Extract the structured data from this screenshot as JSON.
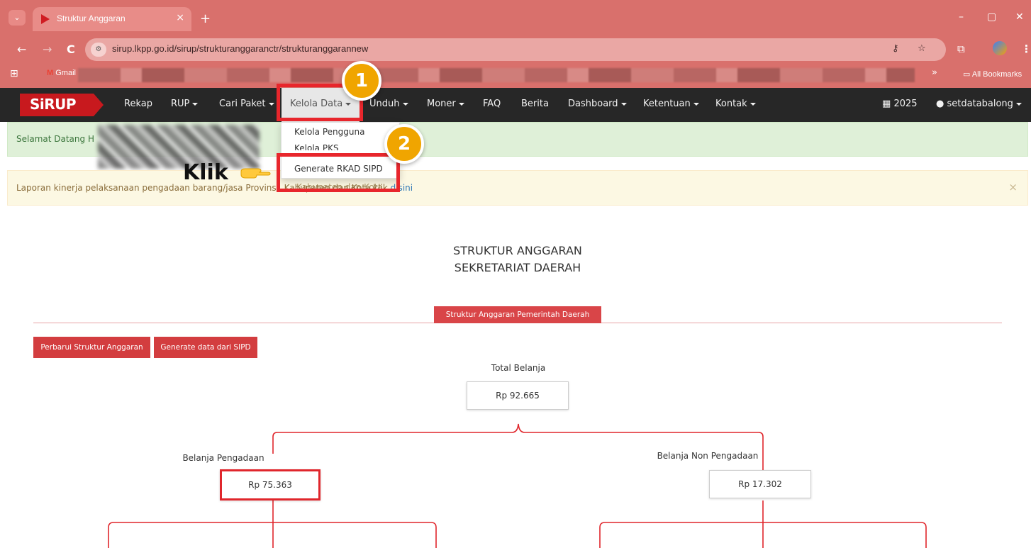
{
  "browser": {
    "tab_title": "Struktur Anggaran",
    "tab_close": "×",
    "new_tab": "+",
    "url": "sirup.lkpp.go.id/sirup/strukturanggaranctr/strukturanggarannew",
    "bookmark_gmail": "Gmail",
    "bookmark_more": "»",
    "bookmark_all": "All Bookmarks",
    "window_controls": [
      "–",
      "▢",
      "✕"
    ],
    "nav_back": "←",
    "nav_forward": "→",
    "nav_reload": "C"
  },
  "app": {
    "logo": "SiRUP",
    "nav": [
      "Rekap",
      "RUP",
      "Cari Paket",
      "Kelola Data",
      "Unduh",
      "Moner",
      "FAQ",
      "Berita",
      "Dashboard",
      "Ketentuan",
      "Kontak"
    ],
    "year": "2025",
    "user": "setdatabalong",
    "accent": "#c8191e",
    "navbar_bg": "#272727"
  },
  "dropdown": {
    "items": [
      "Kelola Pengguna",
      "Kelola PKS",
      "Generate RKAD SIPD"
    ],
    "overlap_text": "Kabupaten dan Kota",
    "highlight": "#e8262c"
  },
  "alerts": {
    "welcome": "Selamat Datang H",
    "warning_text": "Laporan kinerja pelaksanaan pengadaan barang/jasa Provinsi, Kabupaten dan Kota klik ",
    "warning_link": "disini",
    "close": "×"
  },
  "annotation": {
    "step1": "1",
    "step2": "2",
    "klik": "Klik",
    "badge_color": "#f0a500"
  },
  "content": {
    "title_line1": "STRUKTUR ANGGARAN",
    "title_line2": "SEKRETARIAT DAERAH",
    "tab_label": "Struktur Anggaran Pemerintah Daerah",
    "btn_update": "Perbarui Struktur Anggaran",
    "btn_generate": "Generate data dari SIPD",
    "total_label": "Total Belanja",
    "total_value": "Rp 92.665",
    "procure_label": "Belanja Pengadaan",
    "procure_value": "Rp 75.363",
    "nonprocure_label": "Belanja Non Pengadaan",
    "nonprocure_value": "Rp 17.302"
  }
}
